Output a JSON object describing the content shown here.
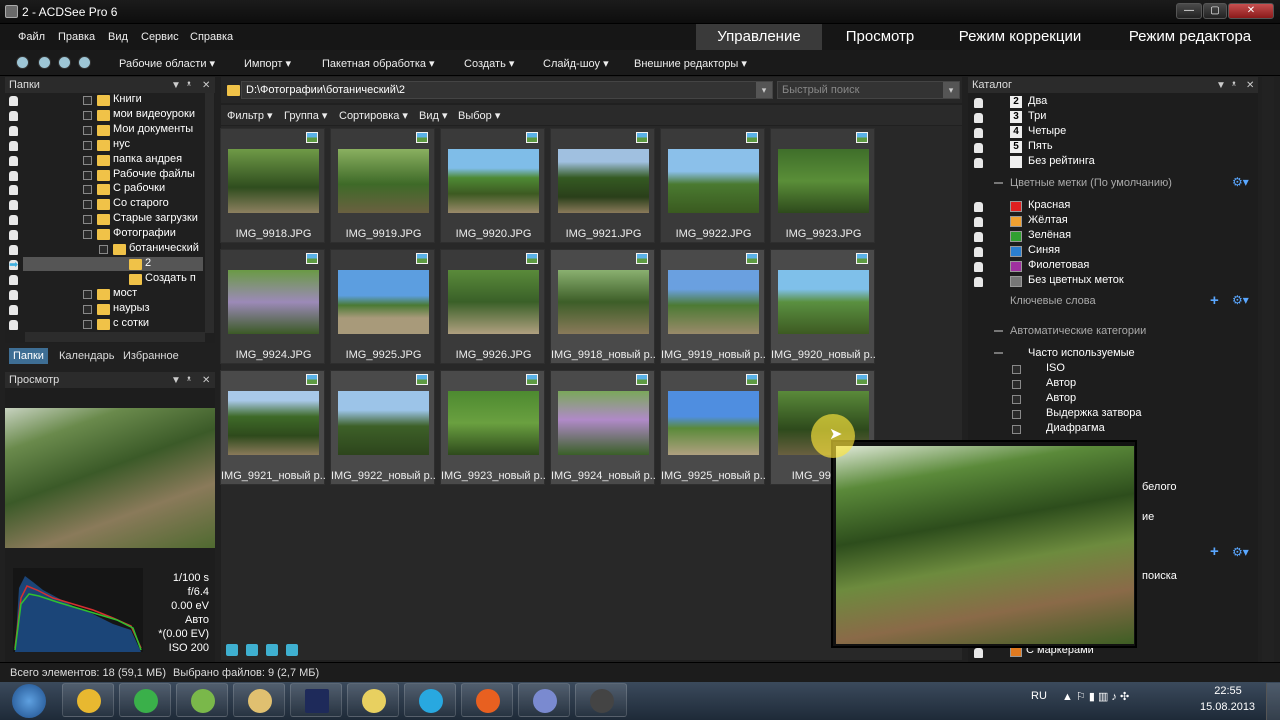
{
  "window": {
    "title": "2 - ACDSee Pro 6",
    "controls": [
      "—",
      "▢",
      "✕"
    ]
  },
  "menu": [
    "Файл",
    "Правка",
    "Вид",
    "Сервис",
    "Справка"
  ],
  "modes": [
    "Управление",
    "Просмотр",
    "Режим коррекции",
    "Режим редактора"
  ],
  "toolbar": [
    "Рабочие области",
    "Импорт",
    "Пакетная обработка",
    "Создать",
    "Слайд-шоу",
    "Внешние редакторы"
  ],
  "folders": {
    "title": "Папки",
    "items": [
      "Книги",
      "мои видеоуроки",
      "Мои документы",
      "нус",
      "папка андрея",
      "Рабочие файлы",
      "С рабочки",
      "Со старого",
      "Старые загрузки",
      "Фотографии",
      "ботанический",
      "2",
      "Создать п",
      "мост",
      "наурыз",
      "с сотки"
    ],
    "tabs": [
      "Папки",
      "Календарь",
      "Избранное"
    ]
  },
  "preview": {
    "title": "Просмотр",
    "exif": [
      "1/100 s",
      "f/6.4",
      "0.00 eV",
      "Авто",
      "*(0.00 EV)",
      "ISO 200"
    ]
  },
  "path": {
    "value": "D:\\Фотографии\\ботанический\\2",
    "search_placeholder": "Быстрый поиск"
  },
  "filterbar": [
    "Фильтр",
    "Группа",
    "Сортировка",
    "Вид",
    "Выбор"
  ],
  "thumbnails": [
    "IMG_9918.JPG",
    "IMG_9919.JPG",
    "IMG_9920.JPG",
    "IMG_9921.JPG",
    "IMG_9922.JPG",
    "IMG_9923.JPG",
    "IMG_9924.JPG",
    "IMG_9925.JPG",
    "IMG_9926.JPG",
    "IMG_9918_новый р...",
    "IMG_9919_новый р...",
    "IMG_9920_новый р...",
    "IMG_9921_новый р...",
    "IMG_9922_новый р...",
    "IMG_9923_новый р...",
    "IMG_9924_новый р...",
    "IMG_9925_новый р...",
    "IMG_9926_н"
  ],
  "catalog": {
    "title": "Каталог",
    "ratings": [
      {
        "num": "2",
        "label": "Два"
      },
      {
        "num": "3",
        "label": "Три"
      },
      {
        "num": "4",
        "label": "Четыре"
      },
      {
        "num": "5",
        "label": "Пять"
      },
      {
        "num": "",
        "label": "Без рейтинга"
      }
    ],
    "color_labels_title": "Цветные метки (По умолчанию)",
    "color_labels": [
      {
        "label": "Красная",
        "color": "#e02020"
      },
      {
        "label": "Жёлтая",
        "color": "#f0a030"
      },
      {
        "label": "Зелёная",
        "color": "#30a030"
      },
      {
        "label": "Синяя",
        "color": "#2a7fd0"
      },
      {
        "label": "Фиолетовая",
        "color": "#a030a0"
      },
      {
        "label": "Без цветных меток",
        "color": "#777777"
      }
    ],
    "keywords_title": "Ключевые слова",
    "auto_title": "Автоматические категории",
    "frequent": "Часто используемые",
    "auto_items": [
      "ISO",
      "Автор",
      "Автор",
      "Выдержка затвора",
      "Диафрагма"
    ],
    "hidden_fragments": [
      "белого",
      "ие",
      "поиска",
      "С маркерами"
    ]
  },
  "status": {
    "total": "Всего элементов: 18  (59,1 МБ)",
    "selected": "Выбрано файлов: 9 (2,7 МБ)"
  },
  "tray": {
    "lang": "RU",
    "time": "22:55",
    "date": "15.08.2013"
  }
}
